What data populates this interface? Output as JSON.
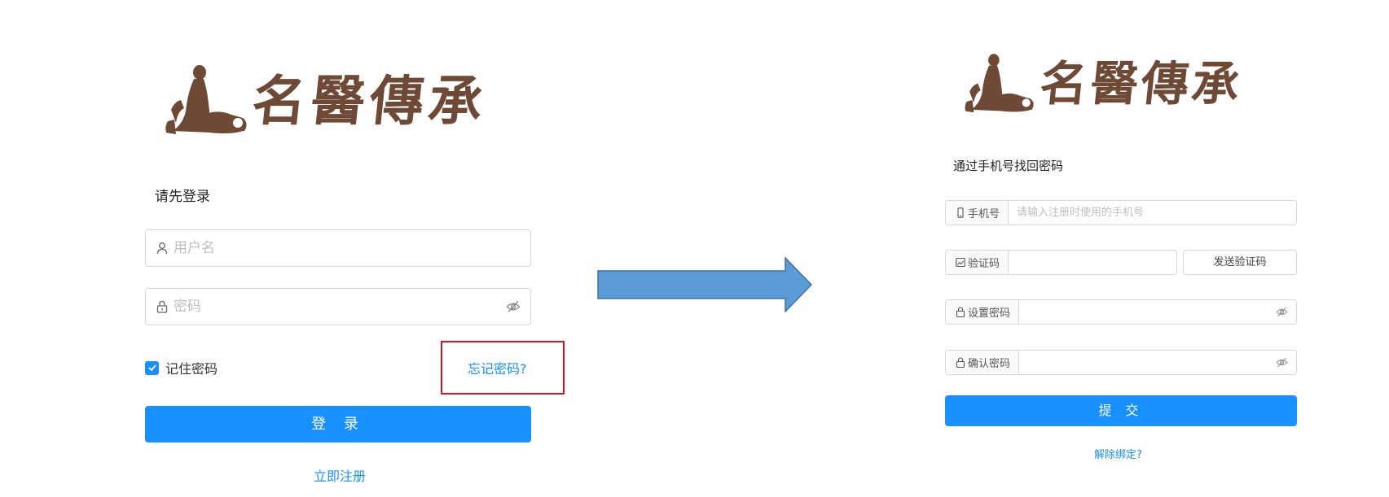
{
  "logo": {
    "text": "名醫傳承",
    "icon": "scholar-figure-icon",
    "color": "#6e4a36"
  },
  "login": {
    "title": "请先登录",
    "username_placeholder": "用户名",
    "password_placeholder": "密码",
    "remember_label": "记住密码",
    "remember_checked": true,
    "forgot_link": "忘记密码?",
    "submit_label": "登 录",
    "register_link": "立即注册"
  },
  "reset": {
    "title": "通过手机号找回密码",
    "phone_label": "手机号",
    "phone_placeholder": "请输入注册时使用的手机号",
    "code_label": "验证码",
    "send_code_label": "发送验证码",
    "set_password_label": "设置密码",
    "confirm_password_label": "确认密码",
    "submit_label": "提 交",
    "unbind_link": "解除绑定?"
  },
  "colors": {
    "primary": "#1890ff",
    "highlight_border": "#d9121b",
    "arrow_fill": "#5b9bd5",
    "arrow_stroke": "#41719c"
  },
  "icons": {
    "user": "user-icon",
    "lock": "lock-icon",
    "eye": "eye-invisible-icon",
    "phone": "mobile-icon",
    "code": "image-code-icon",
    "arrow": "right-arrow-icon"
  }
}
